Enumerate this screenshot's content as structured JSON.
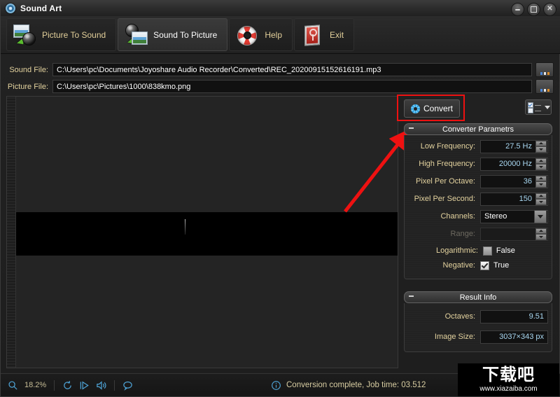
{
  "window": {
    "title": "Sound Art",
    "icon": "app-gear-icon",
    "buttons": {
      "minimize": "minimize",
      "maximize": "maximize",
      "close": "close"
    }
  },
  "toolbar": {
    "tabs": [
      {
        "label": "Picture To Sound",
        "icon": "picture-to-sound-icon",
        "active": false
      },
      {
        "label": "Sound To Picture",
        "icon": "sound-to-picture-icon",
        "active": true
      },
      {
        "label": "Help",
        "icon": "lifebuoy-icon",
        "active": false
      },
      {
        "label": "Exit",
        "icon": "power-switch-icon",
        "active": false
      }
    ]
  },
  "files": {
    "sound": {
      "label": "Sound File:",
      "value": "C:\\Users\\pc\\Documents\\Joyoshare Audio Recorder\\Converted\\REC_20200915152616191.mp3",
      "browse": "..."
    },
    "picture": {
      "label": "Picture File:",
      "value": "C:\\Users\\pc\\Pictures\\1000\\838kmo.png",
      "browse": "..."
    }
  },
  "actions": {
    "convert_label": "Convert",
    "convert_icon": "gear-icon",
    "list_options_icon": "list-options-icon",
    "highlight_color": "#ee1111"
  },
  "converter_parameters": {
    "title": "Converter Parametrs",
    "rows": [
      {
        "label": "Low Frequency:",
        "value": "27.5 Hz",
        "control": "spinner"
      },
      {
        "label": "High Frequency:",
        "value": "20000 Hz",
        "control": "spinner"
      },
      {
        "label": "Pixel Per Octave:",
        "value": "36",
        "control": "spinner"
      },
      {
        "label": "Pixel Per Second:",
        "value": "150",
        "control": "spinner"
      },
      {
        "label": "Channels:",
        "value": "Stereo",
        "control": "combo"
      },
      {
        "label": "Range:",
        "value": "",
        "control": "spinner",
        "disabled": true
      }
    ],
    "checkboxes": [
      {
        "label": "Logarithmic:",
        "value": "False",
        "checked": false
      },
      {
        "label": "Negative:",
        "value": "True",
        "checked": true
      }
    ]
  },
  "result_info": {
    "title": "Result Info",
    "rows": [
      {
        "label": "Octaves:",
        "value": "9.51"
      },
      {
        "label": "Image Size:",
        "value": "3037×343 px"
      }
    ]
  },
  "statusbar": {
    "zoom": "18.2%",
    "zoom_icon": "magnifier-icon",
    "icons": [
      "refresh-icon",
      "play-step-icon",
      "speaker-icon",
      "comment-icon"
    ],
    "info_icon": "info-icon",
    "message": "Conversion complete, Job time: 03.512"
  },
  "watermark": {
    "text": "下载吧",
    "url": "www.xiazaiba.com"
  }
}
